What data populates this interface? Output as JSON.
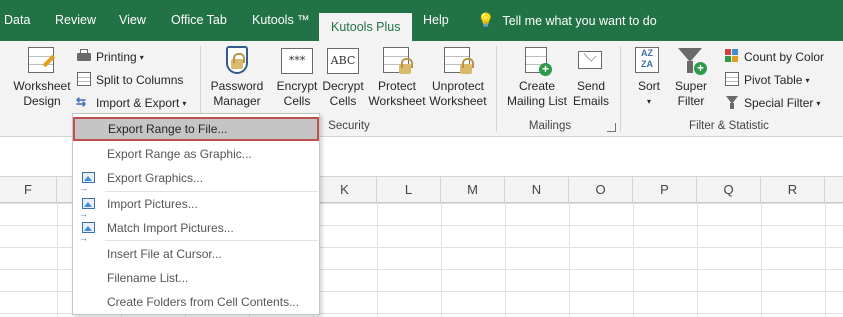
{
  "tabs": [
    {
      "label": "Data"
    },
    {
      "label": "Review"
    },
    {
      "label": "View"
    },
    {
      "label": "Office Tab"
    },
    {
      "label": "Kutools ™"
    },
    {
      "label": "Kutools Plus"
    },
    {
      "label": "Help"
    }
  ],
  "tell_me": {
    "label": "Tell me what you want to do",
    "icon": "lightbulb-icon"
  },
  "ribbon": {
    "worksheet_design": {
      "line1": "Worksheet",
      "line2": "Design"
    },
    "printing": "Printing",
    "split_to_columns": "Split to Columns",
    "import_export": "Import & Export",
    "password_manager": {
      "line1": "Password",
      "line2": "Manager"
    },
    "encrypt_cells": {
      "line1": "Encrypt",
      "line2": "Cells",
      "icon_text": "***"
    },
    "decrypt_cells": {
      "line1": "Decrypt",
      "line2": "Cells",
      "icon_text": "ABC"
    },
    "protect_worksheet": {
      "line1": "Protect",
      "line2": "Worksheet"
    },
    "unprotect_worksheet": {
      "line1": "Unprotect",
      "line2": "Worksheet"
    },
    "security_group": "Security",
    "create_mailing_list": {
      "line1": "Create",
      "line2": "Mailing List"
    },
    "send_emails": {
      "line1": "Send",
      "line2": "Emails"
    },
    "mailings_group": "Mailings",
    "sort": {
      "line1": "Sort"
    },
    "super_filter": {
      "line1": "Super",
      "line2": "Filter"
    },
    "count_by_color": "Count by Color",
    "pivot_table": "Pivot Table",
    "special_filter": "Special Filter",
    "filter_group": "Filter & Statistic"
  },
  "columns": [
    "F",
    "K",
    "L",
    "M",
    "N",
    "O",
    "P",
    "Q",
    "R"
  ],
  "menu": {
    "items": [
      {
        "label": "Export Range to File...",
        "highlighted": true
      },
      {
        "label": "Export Range as Graphic..."
      },
      {
        "label": "Export Graphics..."
      },
      {
        "label": "Import Pictures..."
      },
      {
        "label": "Match Import Pictures..."
      },
      {
        "label": "Insert File at Cursor..."
      },
      {
        "label": "Filename List..."
      },
      {
        "label": "Create Folders from Cell Contents..."
      }
    ]
  },
  "colors": {
    "accent": "#217346",
    "ribbon_bg": "#f3f3f3",
    "highlight_border": "#c0504d",
    "highlight_bg": "#c5c5c5"
  }
}
